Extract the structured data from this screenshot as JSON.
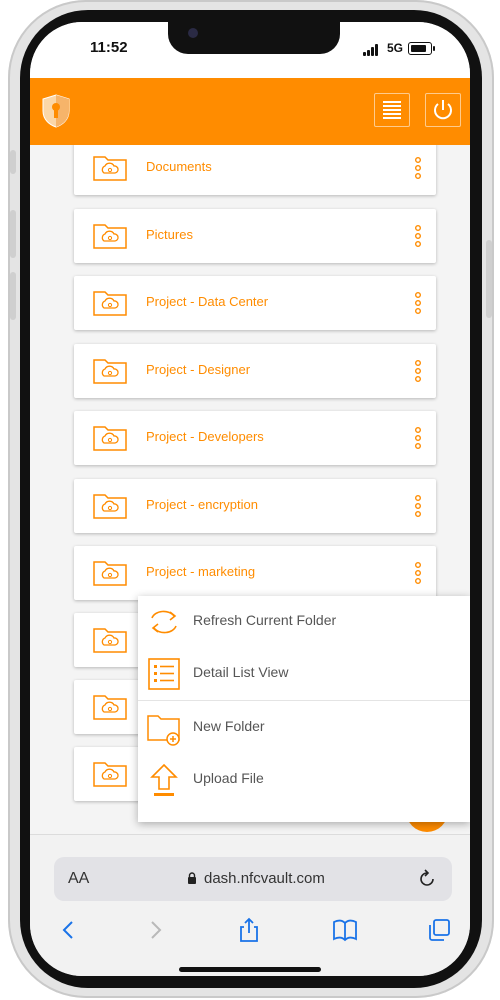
{
  "status_bar": {
    "time": "11:52",
    "network": "5G"
  },
  "header": {
    "menu_icon": "list-menu-icon",
    "power_icon": "power-icon",
    "brand_color": "#ff8c00"
  },
  "folders": [
    {
      "label": "Documents"
    },
    {
      "label": "Pictures"
    },
    {
      "label": "Project - Data Center"
    },
    {
      "label": "Project - Designer"
    },
    {
      "label": "Project - Developers"
    },
    {
      "label": "Project - encryption"
    },
    {
      "label": "Project - marketing"
    },
    {
      "label": ""
    },
    {
      "label": ""
    },
    {
      "label": ""
    }
  ],
  "context_menu": {
    "items": [
      {
        "label": "Refresh Current Folder",
        "icon": "refresh-icon"
      },
      {
        "label": "Detail List View",
        "icon": "detail-list-icon"
      },
      {
        "label": "New Folder",
        "icon": "new-folder-icon"
      },
      {
        "label": "Upload File",
        "icon": "upload-icon"
      }
    ]
  },
  "browser": {
    "text_size_label": "AA",
    "url": "dash.nfcvault.com"
  }
}
